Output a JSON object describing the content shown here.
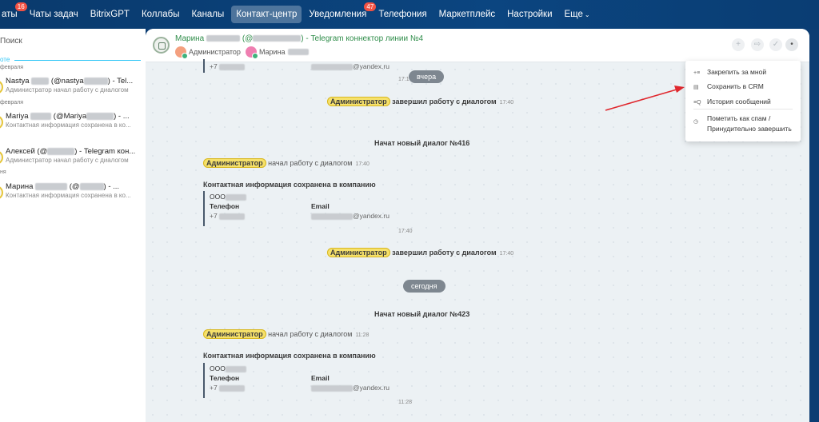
{
  "nav": {
    "items": [
      {
        "label": "аты",
        "badge": "16"
      },
      {
        "label": "Чаты задач",
        "badge": ""
      },
      {
        "label": "BitrixGPT",
        "badge": ""
      },
      {
        "label": "Коллабы",
        "badge": ""
      },
      {
        "label": "Каналы",
        "badge": ""
      },
      {
        "label": "Контакт-центр",
        "badge": "",
        "active": true
      },
      {
        "label": "Уведомления",
        "badge": "47"
      },
      {
        "label": "Телефония",
        "badge": ""
      },
      {
        "label": "Маркетплейс",
        "badge": ""
      },
      {
        "label": "Настройки",
        "badge": ""
      },
      {
        "label": "Еще",
        "badge": ""
      }
    ],
    "more_icon": "chevron-down-icon"
  },
  "sidebar": {
    "search_label": "Поиск",
    "section_label": "оте",
    "dates": [
      "февраля",
      "февраля",
      "ня"
    ],
    "chats": [
      {
        "name_a": "Nastya",
        "name_b": "(@nastya",
        "name_c": ") - Tel...",
        "subtitle": "Администратор начал работу с диалогом"
      },
      {
        "name_a": "Mariya",
        "name_b": "(@Mariya",
        "name_c": ") - ...",
        "subtitle": "Контактная информация сохранена в ко..."
      },
      {
        "name_a": "Алексей (@",
        "name_b": "",
        "name_c": ") - Telegram кон...",
        "subtitle": "Администратор начал работу с диалогом"
      },
      {
        "name_a": "Марина",
        "name_b": "(@",
        "name_c": ") - ...",
        "subtitle": "Контактная информация сохранена в ко..."
      }
    ]
  },
  "header": {
    "title_a": "Марина",
    "title_b": "(@",
    "title_c": ") - Telegram коннектор линии №4",
    "user1": "Администратор",
    "user2": "Марина"
  },
  "messages": {
    "top_phone": "+7",
    "top_email": "@yandex.ru",
    "top_time": "17:1",
    "day1": "вчера",
    "day2": "сегодня",
    "role": "Администратор",
    "finished": "завершил работу с диалогом",
    "started": "начал работу с диалогом",
    "finish_time1": "17:40",
    "new_dialog_prefix": "Начат новый диалог №",
    "dialog1_num": "416",
    "start_time1": "17:40",
    "contact_saved": "Контактная информация сохранена в компанию",
    "company": "ООО",
    "phone_label": "Телефон",
    "email_label": "Email",
    "phone_value": "+7",
    "email_value": "@yandex.ru",
    "contact_time1": "17:40",
    "finish_time2": "17:40",
    "dialog2_num": "423",
    "start_time2": "11:28",
    "contact_time2": "11:28"
  },
  "menu": {
    "items": [
      {
        "label": "Закрепить за мной",
        "icon": "pin-list-icon"
      },
      {
        "label": "Сохранить в CRM",
        "icon": "crm-save-icon"
      },
      {
        "label": "История сообщений",
        "icon": "history-search-icon"
      }
    ],
    "spam_line1": "Пометить как спам /",
    "spam_line2": "Принудительно завершить",
    "spam_icon": "stop-circle-icon"
  },
  "colors": {
    "nav_bg": "#0b4580",
    "accent_blue": "#2fc6f6",
    "role_yellow": "#f6e16a",
    "arrow_red": "#e0282e",
    "title_green": "#2f8d4a"
  }
}
